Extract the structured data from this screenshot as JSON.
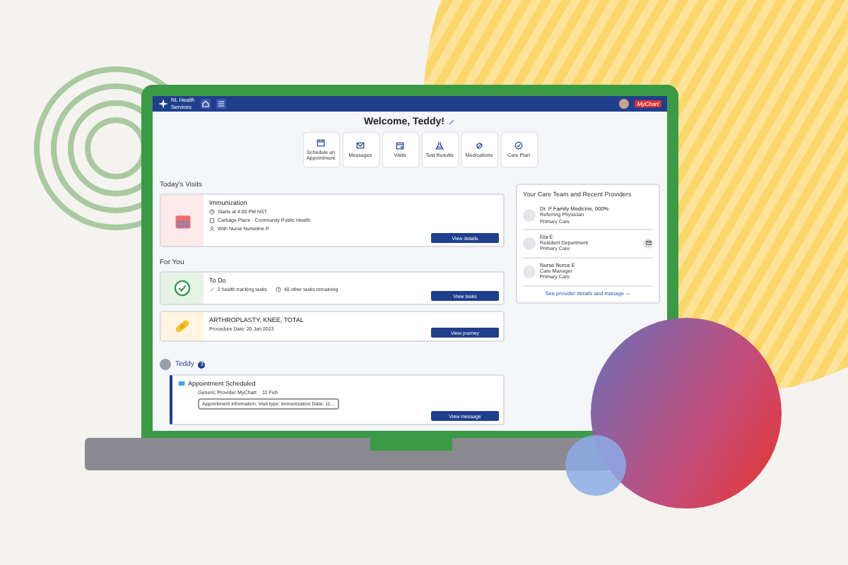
{
  "header": {
    "logo_title": "NL Health",
    "logo_subtitle": "Services",
    "mychart": "MyChart"
  },
  "welcome": "Welcome, Teddy!",
  "shortcuts": [
    {
      "label": "Schedule an Appointment"
    },
    {
      "label": "Messages"
    },
    {
      "label": "Visits"
    },
    {
      "label": "Test Results"
    },
    {
      "label": "Medications"
    },
    {
      "label": "Care Plan"
    }
  ],
  "todays_visits": {
    "heading": "Today's Visits",
    "visits": [
      {
        "title": "Immunization",
        "details": [
          "Starts at 4:00 PM NST",
          "Carbage Place - Community Public Health",
          "With Nurse Nurseline P"
        ],
        "button": "View details"
      }
    ]
  },
  "for_you": {
    "heading": "For You",
    "items": [
      {
        "kind": "todo",
        "title": "To Do",
        "details": [
          "2 health tracking tasks",
          "40 other tasks remaining"
        ],
        "button": "View tasks"
      },
      {
        "kind": "procedure",
        "title": "ARTHROPLASTY, KNEE, TOTAL",
        "details": [
          "Procedure Date: 20 Jan 2023"
        ],
        "button": "View journey"
      }
    ]
  },
  "messages": {
    "name": "Teddy",
    "count": "3",
    "items": [
      {
        "title": "Appointment Scheduled",
        "sender": "Generic Provider MyChart",
        "time": "11 Feb",
        "preview": "Appointment information: Visit type: Immunization Date: 11...",
        "button": "View message"
      }
    ]
  },
  "care_team": {
    "heading": "Your Care Team and Recent Providers",
    "providers": [
      {
        "name": "Dr. P Family Medicine, 000%",
        "role": "Referring Physician",
        "department": "Primary Care",
        "has_message": false
      },
      {
        "name": "Eta E",
        "role": "Resident Department",
        "department": "Primary Care",
        "has_message": true
      },
      {
        "name": "Nurse Nurse E",
        "role": "Care Manager",
        "department": "Primary Care",
        "has_message": false
      }
    ],
    "link": "See provider details and manage →"
  }
}
